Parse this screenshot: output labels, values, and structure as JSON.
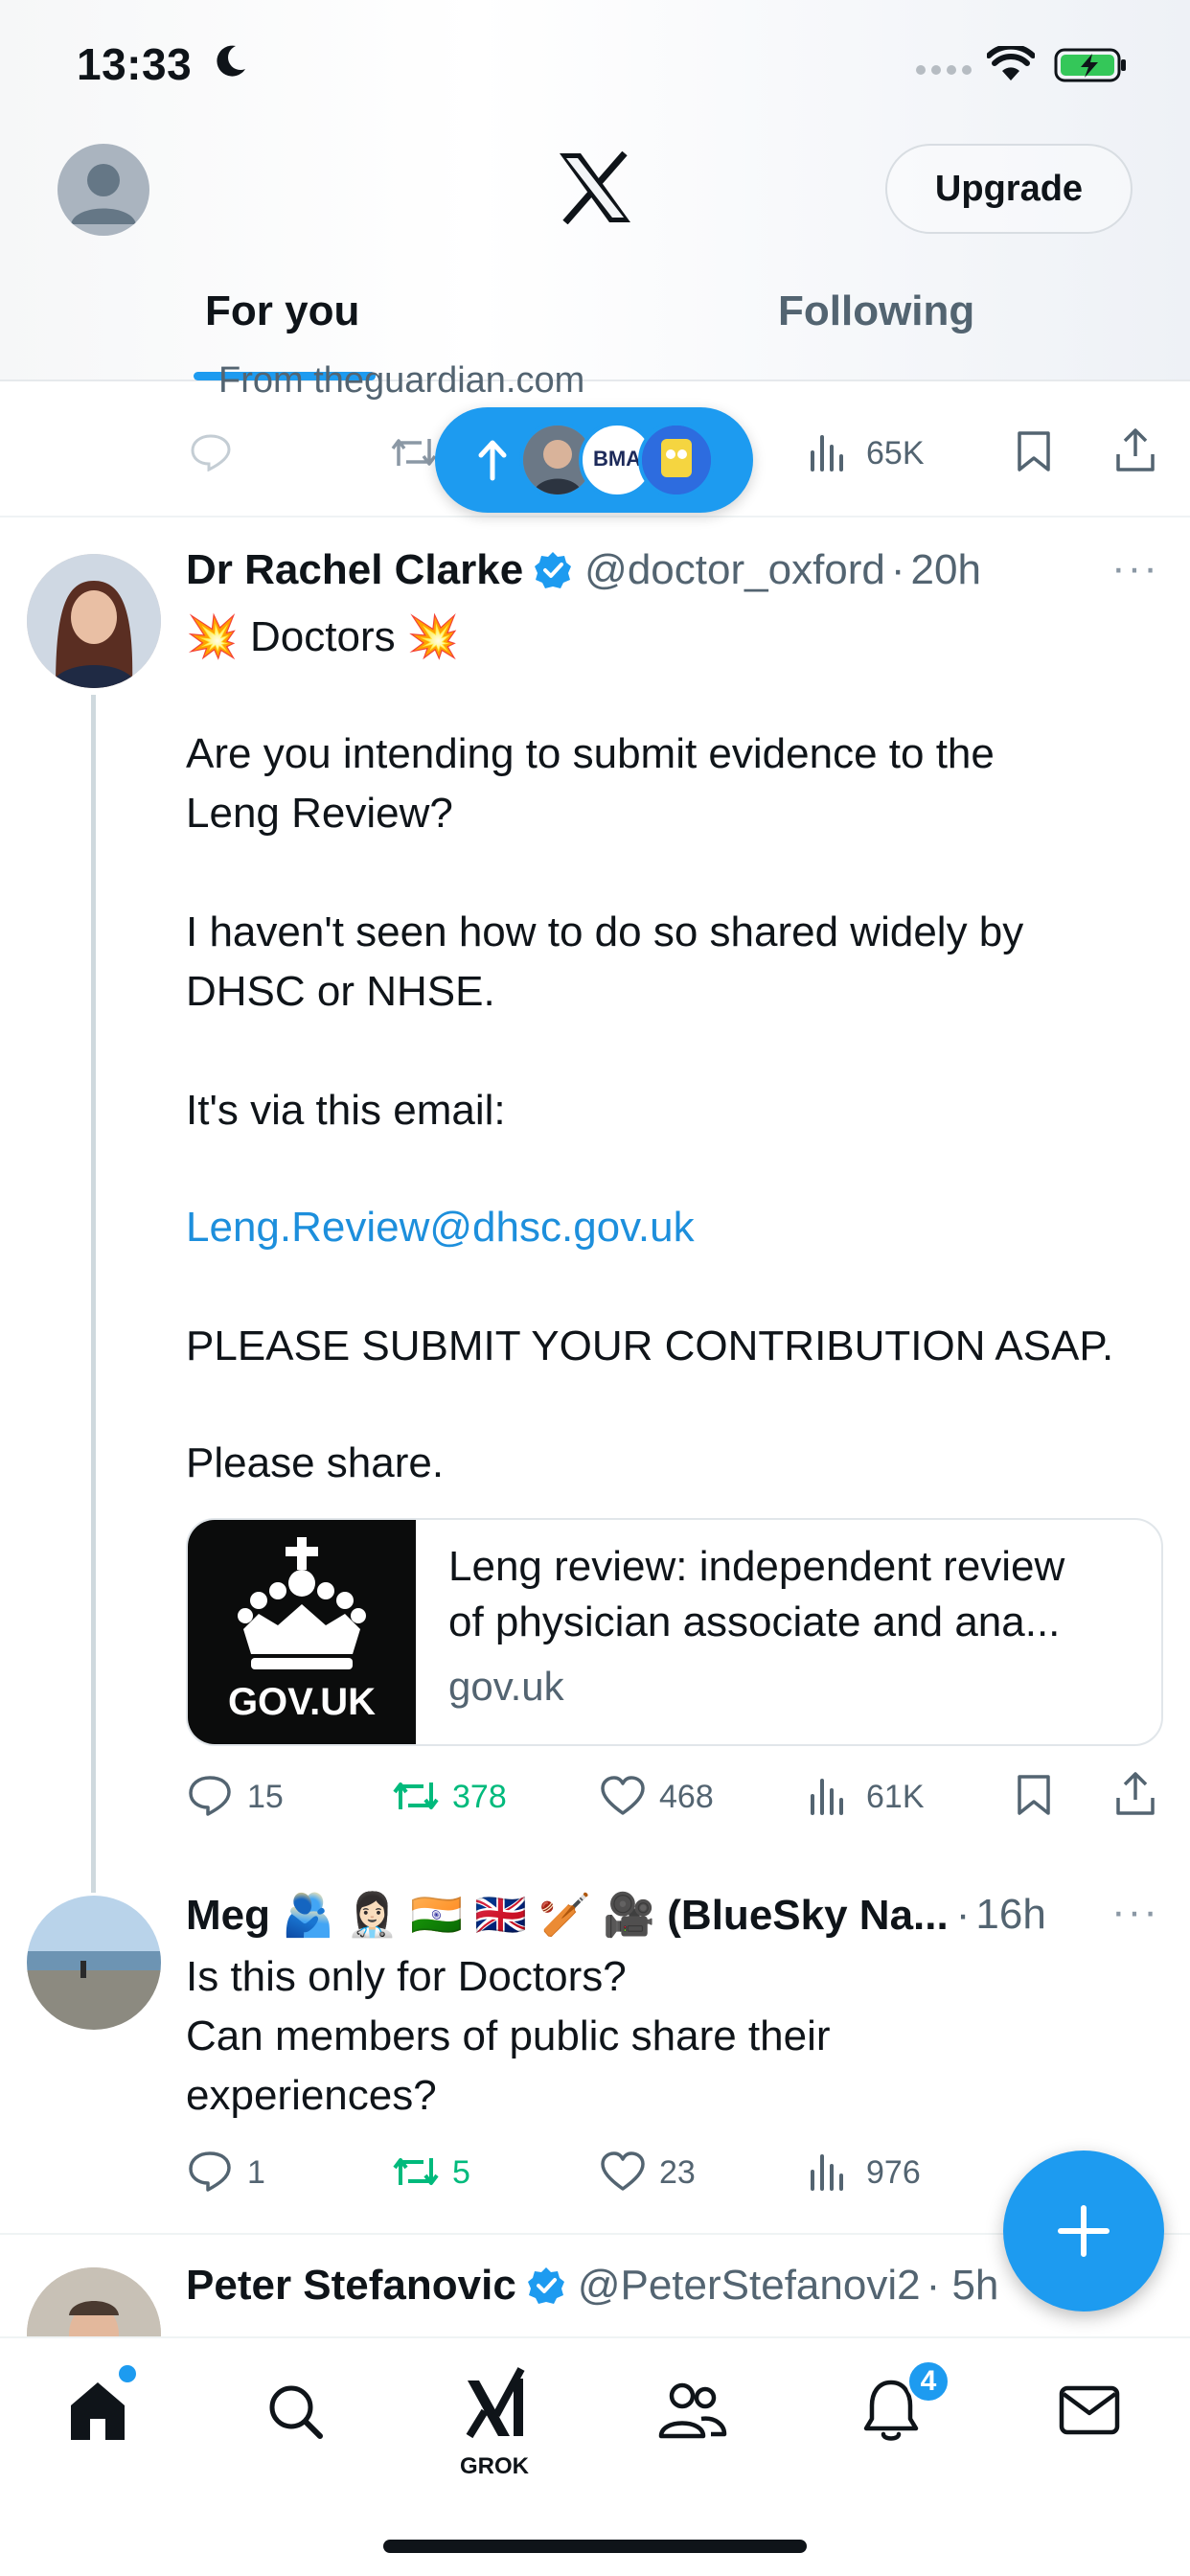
{
  "status_bar": {
    "time": "13:33"
  },
  "header": {
    "upgrade_label": "Upgrade"
  },
  "tabs": [
    {
      "label": "For you",
      "active": true
    },
    {
      "label": "Following",
      "active": false
    }
  ],
  "prev_tweet": {
    "source": "From theguardian.com",
    "views": "65K"
  },
  "new_posts_pill": {
    "badge_text": "BMA"
  },
  "tweet": {
    "display_name": "Dr Rachel Clarke",
    "handle": "@doctor_oxford",
    "time": "20h",
    "more": "···",
    "lines": [
      "💥 Doctors 💥",
      "Are you intending to submit evidence to the",
      "Leng Review?",
      "I haven't seen how to do so shared widely by",
      "DHSC or NHSE.",
      "It's via this email:",
      "Leng.Review@dhsc.gov.uk",
      "PLEASE SUBMIT YOUR CONTRIBUTION ASAP.",
      "Please share."
    ],
    "card": {
      "thumb_label": "GOV.UK",
      "title_line1": "Leng review: independent review",
      "title_line2": "of physician associate and ana...",
      "domain": "gov.uk"
    },
    "stats": {
      "replies": "15",
      "reposts": "378",
      "likes": "468",
      "views": "61K"
    }
  },
  "reply": {
    "display_name": "Meg 🫂 👩🏻‍⚕️ 🇮🇳 🇬🇧 🏏 🎥 (BlueSky Na...",
    "time": "16h",
    "more": "···",
    "lines": [
      "Is this only for Doctors?",
      "Can members of public share their",
      "experiences?"
    ],
    "stats": {
      "replies": "1",
      "reposts": "5",
      "likes": "23",
      "views": "976"
    }
  },
  "next_tweet": {
    "display_name": "Peter Stefanovic",
    "handle": "@PeterStefanovi2",
    "time_partial": "· 5h"
  },
  "bottom_nav": {
    "grok_label": "GROK",
    "notifications_badge": "4"
  },
  "colors": {
    "accent": "#1d9bf0",
    "repost_green": "#00ba7c",
    "muted": "#536471",
    "link": "#1d8fdc"
  },
  "icons": [
    "moon-icon",
    "wifi-icon",
    "battery-charging-icon",
    "x-logo-icon",
    "reply-icon",
    "repost-icon",
    "like-icon",
    "views-icon",
    "bookmark-icon",
    "share-icon",
    "verified-badge-icon",
    "crown-icon",
    "compose-plus-icon",
    "home-icon",
    "search-icon",
    "grok-icon",
    "communities-icon",
    "notifications-icon",
    "messages-icon"
  ]
}
